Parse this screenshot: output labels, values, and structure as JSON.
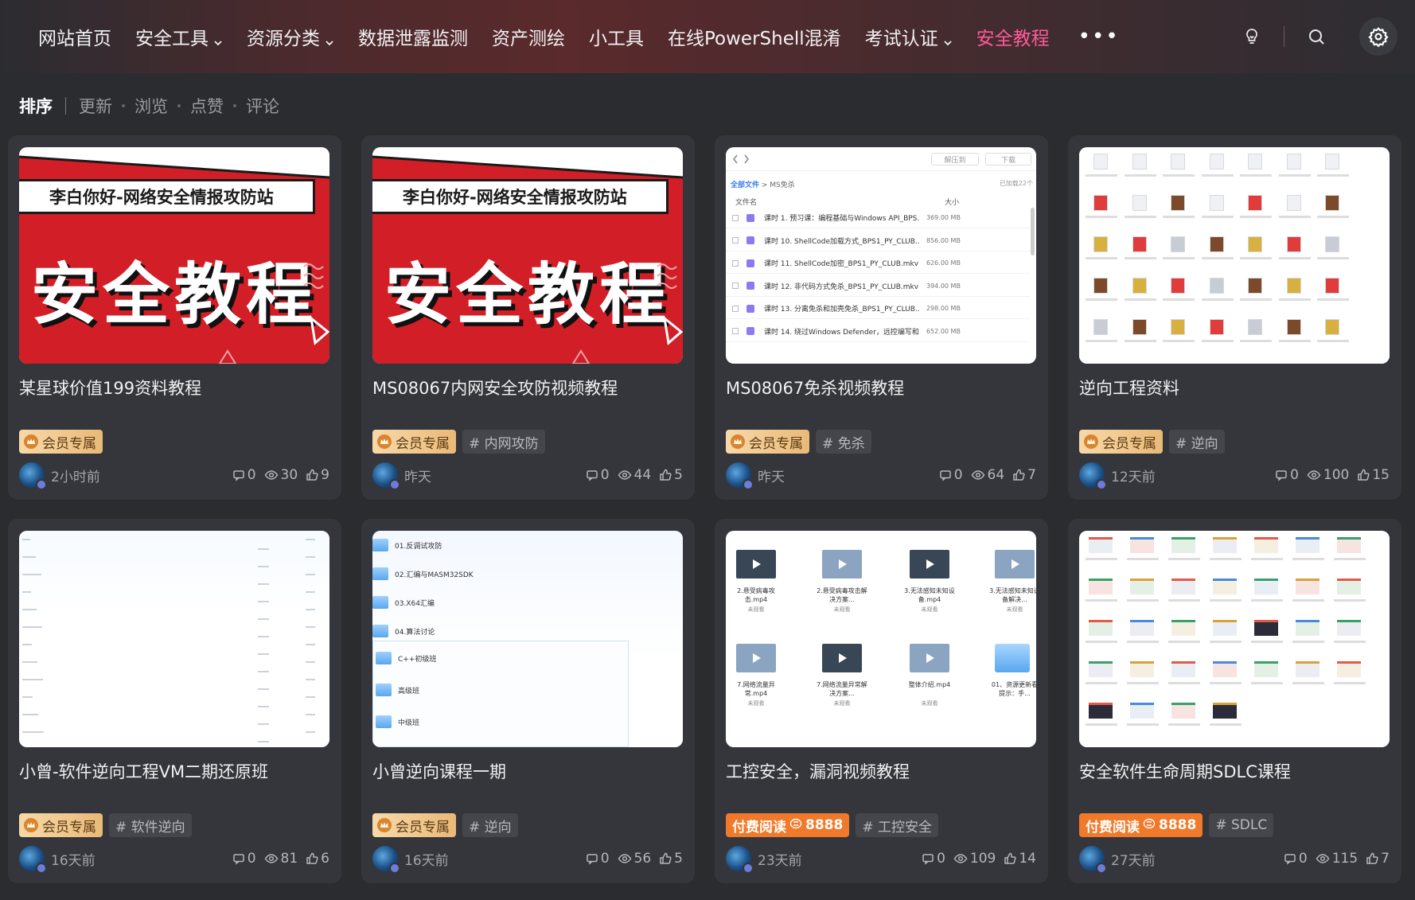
{
  "nav": {
    "items": [
      {
        "label": "网站首页",
        "dropdown": false,
        "active": false
      },
      {
        "label": "安全工具",
        "dropdown": true,
        "active": false
      },
      {
        "label": "资源分类",
        "dropdown": true,
        "active": false
      },
      {
        "label": "数据泄露监测",
        "dropdown": false,
        "active": false
      },
      {
        "label": "资产测绘",
        "dropdown": false,
        "active": false
      },
      {
        "label": "小工具",
        "dropdown": false,
        "active": false
      },
      {
        "label": "在线PowerShell混淆",
        "dropdown": false,
        "active": false
      },
      {
        "label": "考试认证",
        "dropdown": true,
        "active": false
      },
      {
        "label": "安全教程",
        "dropdown": false,
        "active": true
      }
    ],
    "more": "•••",
    "active_color": "#ff5a9a"
  },
  "sort": {
    "title": "排序",
    "options": [
      "更新",
      "浏览",
      "点赞",
      "评论"
    ]
  },
  "banner": {
    "strip_text": "李白你好-网络安全情报攻防站",
    "big_text": "安全教程"
  },
  "filelist": {
    "btn1": "解压到",
    "btn2": "下载",
    "crumb_root": "全部文件",
    "crumb_sep": " > ",
    "crumb_leaf": "MS免杀",
    "count": "已加载22个",
    "col_name": "文件名",
    "col_size": "大小",
    "rows": [
      {
        "name": "课时 1. 预习课：编程基础与Windows API_BPS...",
        "size": "369.00 MB"
      },
      {
        "name": "课时 10. ShellCode加载方式_BPS1_PY_CLUB....",
        "size": "856.00 MB"
      },
      {
        "name": "课时 11. ShellCode加密_BPS1_PY_CLUB.mkv",
        "size": "626.00 MB"
      },
      {
        "name": "课时 12. 非代码方式免杀_BPS1_PY_CLUB.mkv",
        "size": "394.00 MB"
      },
      {
        "name": "课时 13. 分离免杀和加壳免杀_BPS1_PY_CLUB....",
        "size": "298.00 MB"
      },
      {
        "name": "课时 14. 绕过Windows Defender，远控编写和...",
        "size": "652.00 MB"
      }
    ]
  },
  "tree": {
    "rows": [
      "01.反调试攻防",
      "02.汇编与MASM32SDK",
      "03.X64汇编",
      "04.算法讨论"
    ],
    "sub_rows": [
      "C++初级班",
      "高级班",
      "中级班"
    ]
  },
  "videos": {
    "row1": [
      {
        "name": "2.悬受病毒攻击.mp4",
        "sub": "未观看"
      },
      {
        "name": "2.悬受病毒攻击解决方案...",
        "sub": "未观看"
      },
      {
        "name": "3.无法感知未知设备.mp4",
        "sub": "未观看"
      },
      {
        "name": "3.无法感知未知设备解决...",
        "sub": "未观看"
      }
    ],
    "row2": [
      {
        "name": "7.网络流量异常.mp4",
        "sub": "未观看"
      },
      {
        "name": "7.网络流量异常解决方案...",
        "sub": "未观看"
      },
      {
        "name": "整体介绍.mp4",
        "sub": "未观看"
      },
      {
        "name": "01、资源更新看提示：手...",
        "sub": ""
      }
    ]
  },
  "cards": [
    {
      "title": "某星球价值199资料教程",
      "thumb": "banner",
      "badge": {
        "type": "vip",
        "label": "会员专属"
      },
      "topic": "",
      "time": "2小时前",
      "comments": "0",
      "views": "30",
      "likes": "9"
    },
    {
      "title": "MS08067内网安全攻防视频教程",
      "thumb": "banner",
      "badge": {
        "type": "vip",
        "label": "会员专属"
      },
      "topic": "# 内网攻防",
      "time": "昨天",
      "comments": "0",
      "views": "44",
      "likes": "5"
    },
    {
      "title": "MS08067免杀视频教程",
      "thumb": "filelist",
      "badge": {
        "type": "vip",
        "label": "会员专属"
      },
      "topic": "# 免杀",
      "time": "昨天",
      "comments": "0",
      "views": "64",
      "likes": "7"
    },
    {
      "title": "逆向工程资料",
      "thumb": "docgrid",
      "badge": {
        "type": "vip",
        "label": "会员专属"
      },
      "topic": "# 逆向",
      "time": "12天前",
      "comments": "0",
      "views": "100",
      "likes": "15"
    },
    {
      "title": "小曾-软件逆向工程VM二期还原班",
      "thumb": "lines",
      "badge": {
        "type": "vip",
        "label": "会员专属"
      },
      "topic": "# 软件逆向",
      "time": "16天前",
      "comments": "0",
      "views": "81",
      "likes": "6"
    },
    {
      "title": "小曾逆向课程一期",
      "thumb": "tree",
      "badge": {
        "type": "vip",
        "label": "会员专属"
      },
      "topic": "# 逆向",
      "time": "16天前",
      "comments": "0",
      "views": "56",
      "likes": "5"
    },
    {
      "title": "工控安全，漏洞视频教程",
      "thumb": "videos",
      "badge": {
        "type": "paid",
        "label": "付费阅读",
        "price": "8888"
      },
      "topic": "# 工控安全",
      "time": "23天前",
      "comments": "0",
      "views": "109",
      "likes": "14"
    },
    {
      "title": "安全软件生命周期SDLC课程",
      "thumb": "screens",
      "badge": {
        "type": "paid",
        "label": "付费阅读",
        "price": "8888"
      },
      "topic": "# SDLC",
      "time": "27天前",
      "comments": "0",
      "views": "115",
      "likes": "7"
    }
  ]
}
